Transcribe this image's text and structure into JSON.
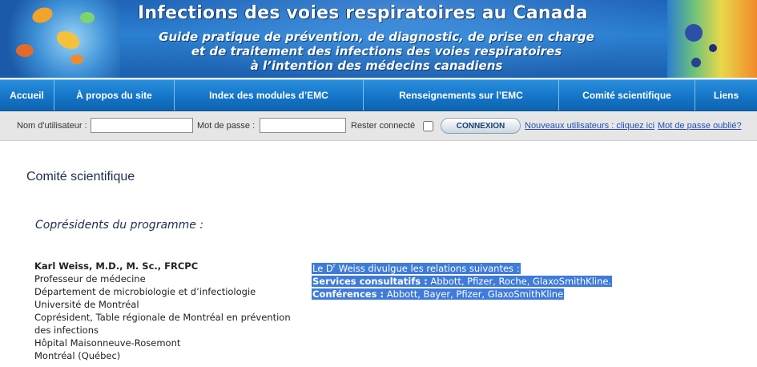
{
  "banner": {
    "title": "Infections des voies respiratoires au Canada",
    "subtitle_lines": [
      "Guide pratique de prévention, de diagnostic, de prise en charge",
      "et de traitement des infections des voies respiratoires",
      "à l’intention des médecins canadiens"
    ]
  },
  "nav": {
    "items": [
      {
        "label": "Accueil"
      },
      {
        "label": "À propos du site"
      },
      {
        "label": "Index des modules d’EMC"
      },
      {
        "label": "Renseignements sur l’EMC"
      },
      {
        "label": "Comité scientifique"
      },
      {
        "label": "Liens"
      }
    ]
  },
  "login": {
    "username_label": "Nom d'utilisateur :",
    "username_value": "",
    "password_label": "Mot de passe :",
    "password_value": "",
    "remember_label": "Rester connecté",
    "remember_checked": false,
    "submit_label": "CONNEXION",
    "new_users_link": "Nouveaux utilisateurs : cliquez ici",
    "forgot_link": "Mot de passe oublié?"
  },
  "content": {
    "page_title": "Comité scientifique",
    "section_heading": "Coprésidents du programme :",
    "person": {
      "name": "Karl Weiss, M.D., M. Sc., FRCPC",
      "details": [
        "Professeur de médecine",
        "Département de microbiologie et d’infectiologie",
        "Université de Montréal",
        "Coprésident, Table régionale de Montréal en prévention des infections",
        "Hôpital Maisonneuve-Rosemont",
        "Montréal (Québec)"
      ]
    },
    "disclosure": {
      "intro_prefix": "Le D",
      "intro_sup": "r",
      "intro_suffix": " Weiss divulgue les relations suivantes :",
      "consulting_label": "Services consultatifs :",
      "consulting_value": " Abbott, Pfizer, Roche, GlaxoSmithKline.",
      "conferences_label": "Conférences :",
      "conferences_value": " Abbott, Bayer, Pfizer, GlaxoSmithKline"
    }
  },
  "colors": {
    "banner_blue": "#1f64b8",
    "nav_blue": "#1677c9",
    "heading_navy": "#1e2d52",
    "selection_blue": "#3f7bd8",
    "link_blue": "#1f4fb3"
  }
}
